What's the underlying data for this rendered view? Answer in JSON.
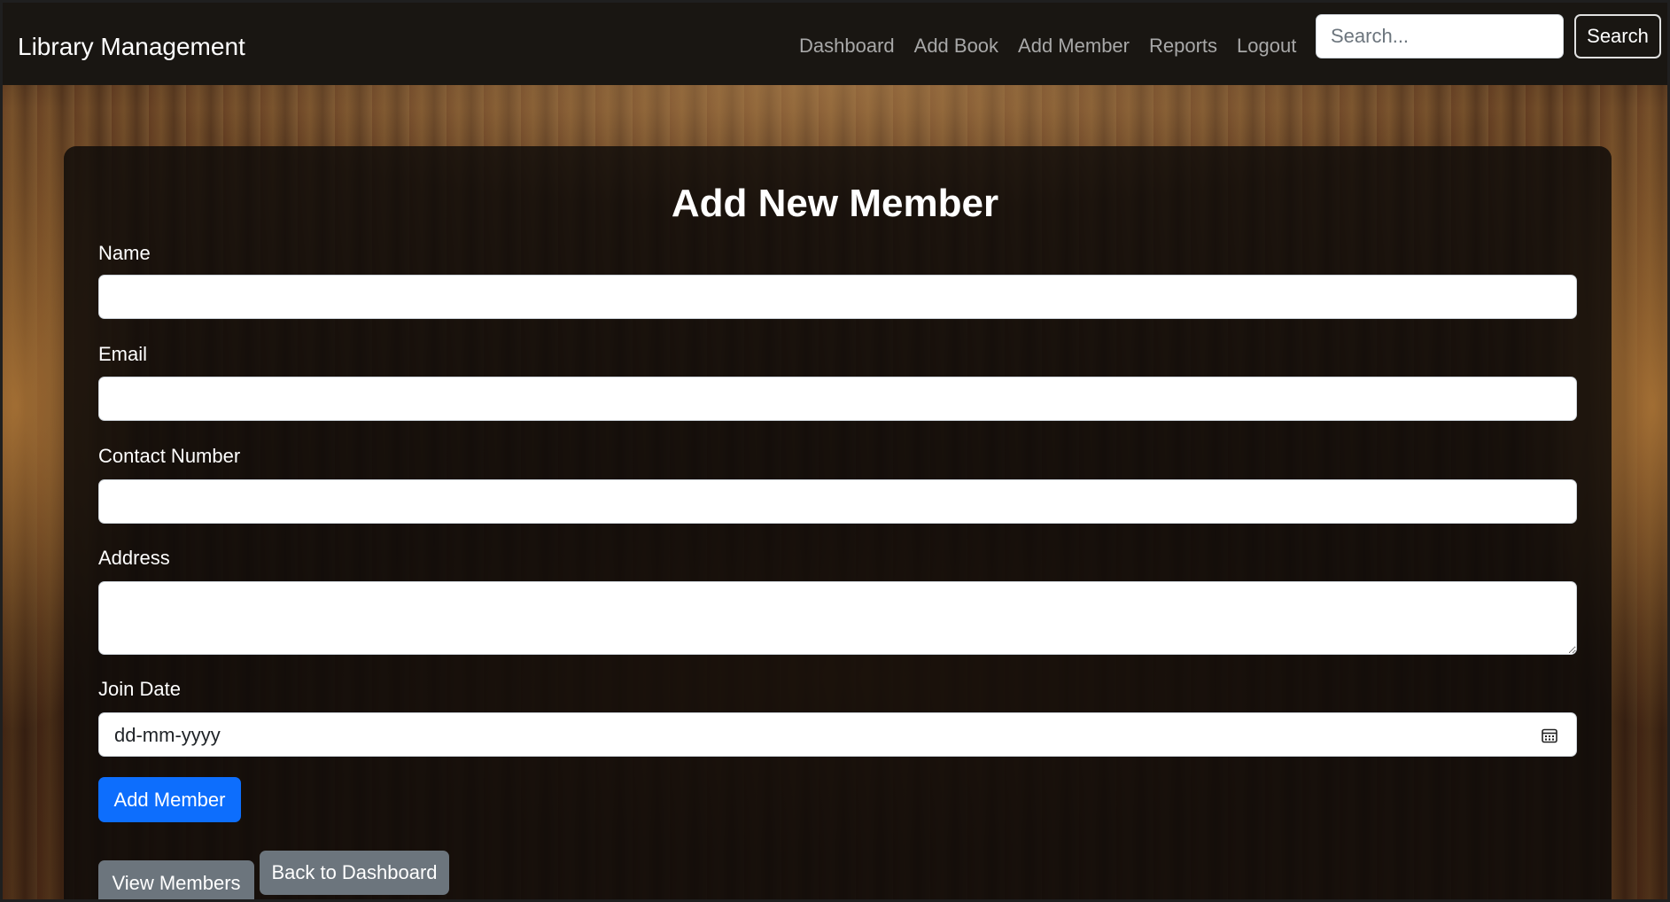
{
  "navbar": {
    "brand": "Library Management",
    "links": [
      "Dashboard",
      "Add Book",
      "Add Member",
      "Reports",
      "Logout"
    ],
    "search": {
      "placeholder": "Search...",
      "value": "",
      "button_label": "Search"
    }
  },
  "form": {
    "title": "Add New Member",
    "fields": {
      "name": {
        "label": "Name",
        "value": ""
      },
      "email": {
        "label": "Email",
        "value": ""
      },
      "contact": {
        "label": "Contact Number",
        "value": ""
      },
      "address": {
        "label": "Address",
        "value": ""
      },
      "join_date": {
        "label": "Join Date",
        "value": "dd-mm-yyyy"
      }
    },
    "submit_label": "Add Member"
  },
  "actions": {
    "view_members_label": "View Members",
    "back_label": "Back to Dashboard"
  },
  "colors": {
    "primary": "#0d6efd",
    "secondary": "#6c757d",
    "navbar_bg": "#191612",
    "nav_link": "#a8a8a8"
  },
  "icons": {
    "date_picker": "calendar-icon"
  }
}
